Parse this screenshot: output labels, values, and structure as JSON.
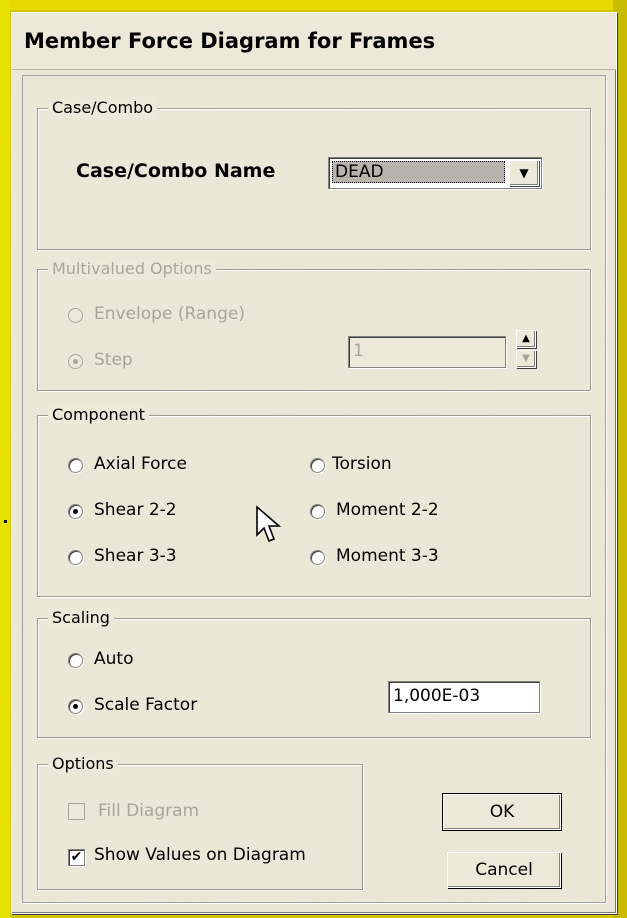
{
  "window": {
    "title": "Member Force Diagram for Frames"
  },
  "case_combo": {
    "group_label": "Case/Combo",
    "name_label": "Case/Combo Name",
    "selected_value": "DEAD"
  },
  "multivalued": {
    "group_label": "Multivalued Options",
    "envelope_label": "Envelope (Range)",
    "step_label": "Step",
    "step_value": "1",
    "selected": "Step",
    "enabled": false
  },
  "component": {
    "group_label": "Component",
    "options": [
      "Axial Force",
      "Torsion",
      "Shear 2-2",
      "Moment 2-2",
      "Shear 3-3",
      "Moment 3-3"
    ],
    "selected": "Shear 2-2"
  },
  "scaling": {
    "group_label": "Scaling",
    "auto_label": "Auto",
    "scale_factor_label": "Scale Factor",
    "scale_factor_value": "1,000E-03",
    "selected": "Scale Factor"
  },
  "options": {
    "group_label": "Options",
    "fill_diagram_label": "Fill Diagram",
    "fill_diagram_checked": false,
    "fill_diagram_enabled": false,
    "show_values_label": "Show Values on Diagram",
    "show_values_checked": true
  },
  "buttons": {
    "ok": "OK",
    "cancel": "Cancel"
  },
  "colors": {
    "frame_yellow": "#d4c600",
    "dialog_bg": "#ece9d8",
    "disabled_text": "#a8a69a"
  },
  "icons": {
    "checkmark": "✔",
    "arrow_down": "▼",
    "arrow_up": "▲"
  }
}
